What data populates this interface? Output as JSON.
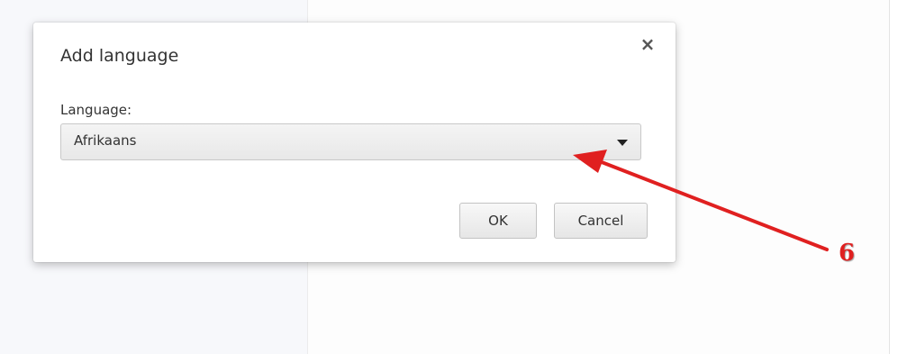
{
  "dialog": {
    "title": "Add language",
    "close_glyph": "×",
    "field_label": "Language:",
    "selected_language": "Afrikaans",
    "ok_label": "OK",
    "cancel_label": "Cancel"
  },
  "annotation": {
    "step_number": "6",
    "arrow_color": "#e02020"
  },
  "icons": {
    "close": "close-icon",
    "dropdown": "chevron-down-icon"
  },
  "colors": {
    "left_panel_bg": "#f7f8fb",
    "dialog_bg": "#ffffff",
    "annotation_red": "#e02020"
  }
}
